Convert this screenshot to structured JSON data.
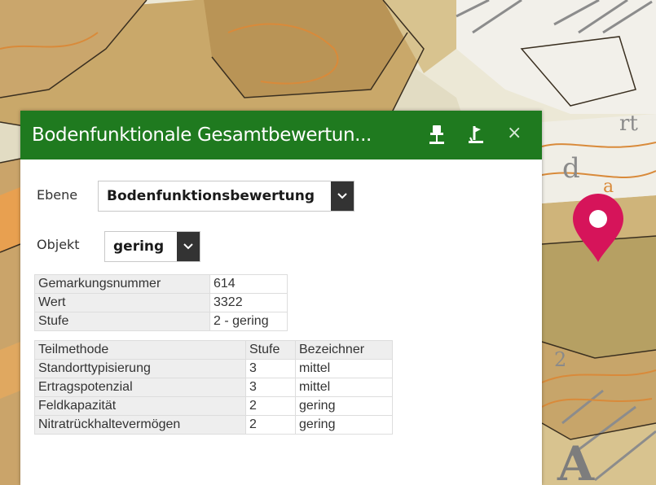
{
  "map": {
    "labels": {
      "a_large": "A",
      "d_partial": "d",
      "ha_partial": "a",
      "rt_partial": "rt",
      "number_partial": "2"
    }
  },
  "marker": {
    "icon": "map-pin-icon",
    "color": "#d6145a"
  },
  "popup": {
    "title": "Bodenfunktionale Gesamtbewertun...",
    "header_color": "#1f7a1f",
    "buttons": {
      "pin_icon": "pin-icon",
      "unpin_icon": "unpin-icon",
      "close_label": "×"
    },
    "ebene": {
      "label": "Ebene",
      "value": "Bodenfunktionsbewertung"
    },
    "objekt": {
      "label": "Objekt",
      "value": "gering"
    },
    "attributes": [
      {
        "key": "Gemarkungsnummer",
        "value": "614"
      },
      {
        "key": "Wert",
        "value": "3322"
      },
      {
        "key": "Stufe",
        "value": "2 - gering"
      }
    ],
    "methods": {
      "headers": [
        "Teilmethode",
        "Stufe",
        "Bezeichner"
      ],
      "rows": [
        {
          "name": "Standorttypisierung",
          "stufe": "3",
          "bezeichner": "mittel"
        },
        {
          "name": "Ertragspotenzial",
          "stufe": "3",
          "bezeichner": "mittel"
        },
        {
          "name": "Feldkapazität",
          "stufe": "2",
          "bezeichner": "gering"
        },
        {
          "name": "Nitratrückhaltevermögen",
          "stufe": "2",
          "bezeichner": "gering"
        }
      ]
    }
  }
}
